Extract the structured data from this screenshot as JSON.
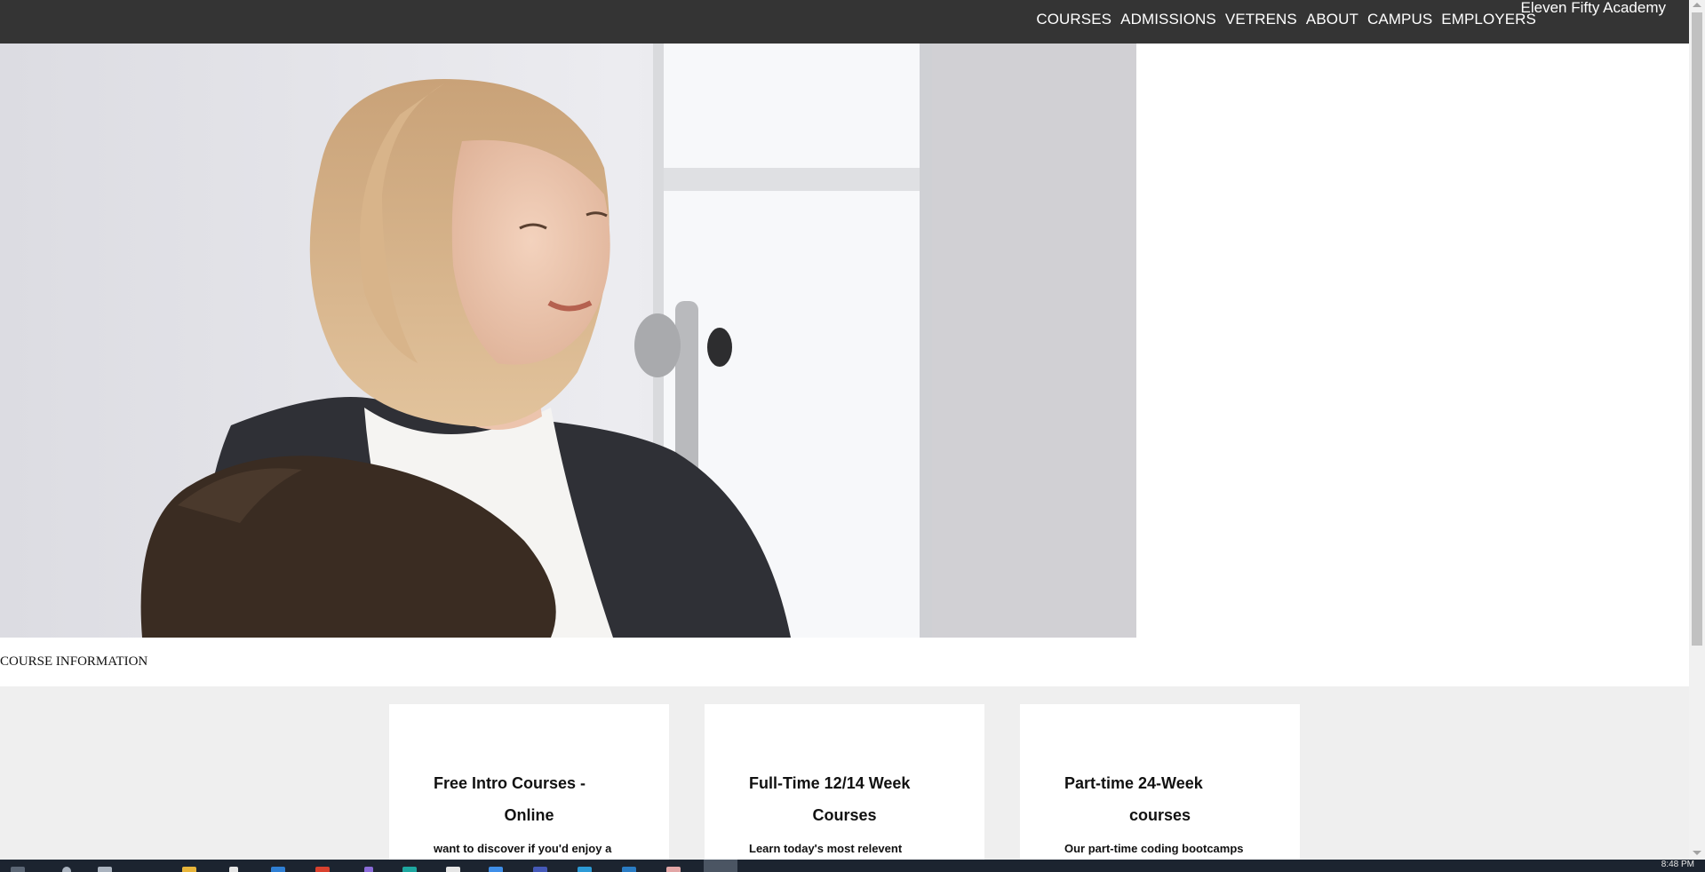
{
  "nav": {
    "items": [
      "COURSES",
      "ADMISSIONS",
      "VETRENS",
      "ABOUT",
      "CAMPUS",
      "EMPLOYERS"
    ],
    "brand": "Eleven Fifty Academy"
  },
  "section_label": "COURSE INFORMATION",
  "cards": [
    {
      "title_line1": "Free Intro Courses -",
      "title_line2": "Online",
      "desc": "want to discover if you'd enjoy a"
    },
    {
      "title_line1": "Full-Time 12/14 Week",
      "title_line2": "Courses",
      "desc": "Learn today's most relevent"
    },
    {
      "title_line1": "Part-time 24-Week",
      "title_line2": "courses",
      "desc": "Our part-time coding bootcamps"
    }
  ],
  "taskbar": {
    "clock": "8:48 PM"
  },
  "colors": {
    "nav_bg": "#343434",
    "page_bg": "#efefef",
    "card_bg": "#ffffff"
  }
}
